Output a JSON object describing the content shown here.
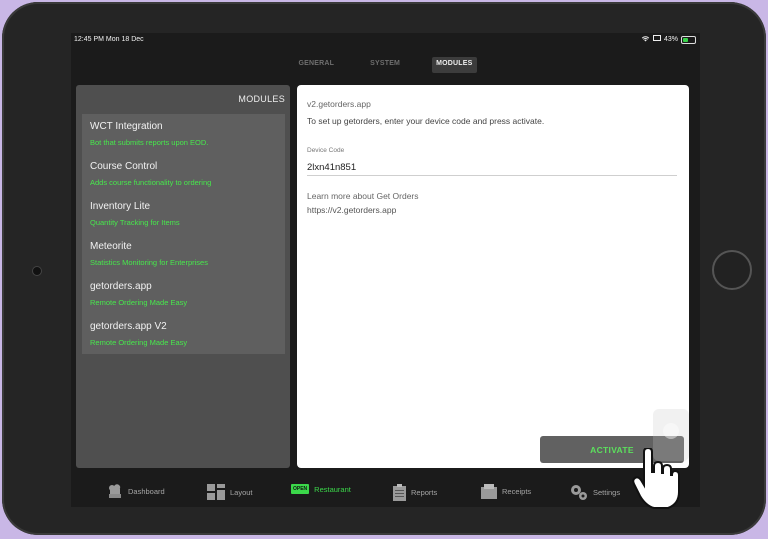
{
  "status_bar": {
    "time": "12:45 PM  Mon 18 Dec",
    "battery": "43%",
    "battery_level": 0.43
  },
  "top_tabs": [
    {
      "label": "GENERAL",
      "active": false
    },
    {
      "label": "SYSTEM",
      "active": false
    },
    {
      "label": "MODULES",
      "active": true
    }
  ],
  "modules_panel": {
    "header": "MODULES",
    "items": [
      {
        "name": "WCT Integration",
        "desc": "Bot that submits reports upon EOD."
      },
      {
        "name": "Course Control",
        "desc": "Adds course functionality to ordering"
      },
      {
        "name": "Inventory Lite",
        "desc": "Quantity Tracking for Items"
      },
      {
        "name": "Meteorite",
        "desc": "Statistics Monitoring for Enterprises"
      },
      {
        "name": "getorders.app",
        "desc": "Remote Ordering Made Easy"
      },
      {
        "name": "getorders.app V2",
        "desc": "Remote Ordering Made Easy"
      }
    ]
  },
  "detail": {
    "title": "v2.getorders.app",
    "instructions": "To set up getorders, enter your device code and press activate.",
    "device_code_label": "Device Code",
    "device_code_value": "2lxn41n851",
    "learn_more": "Learn more about Get Orders",
    "url": "https://v2.getorders.app",
    "activate_label": "ACTIVATE"
  },
  "bottom_tabs": [
    {
      "label": "Dashboard",
      "icon": "chef-icon"
    },
    {
      "label": "Layout",
      "icon": "layout-icon"
    },
    {
      "label": "Restaurant",
      "icon": "open-sign-icon",
      "badge": "OPEN",
      "active": true
    },
    {
      "label": "Reports",
      "icon": "clipboard-icon"
    },
    {
      "label": "Receipts",
      "icon": "receipt-icon"
    },
    {
      "label": "Settings",
      "icon": "gears-icon"
    }
  ],
  "colors": {
    "accent_green": "#3bd84a",
    "panel_bg": "#4f4f4f",
    "screen_bg": "#1b1b1b"
  }
}
